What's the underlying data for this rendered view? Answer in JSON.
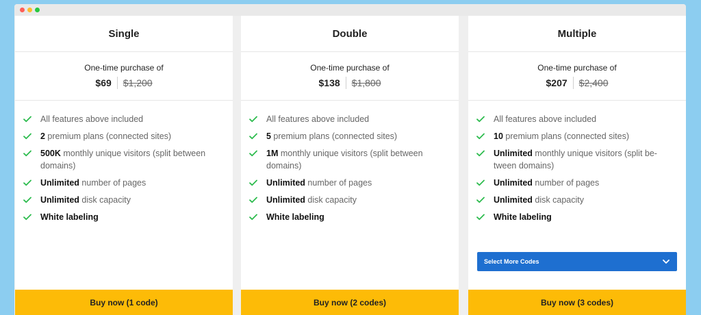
{
  "window": {
    "controls": [
      "close",
      "minimize",
      "maximize"
    ]
  },
  "accent": {
    "check": "#2ebc4f",
    "buy": "#fdbb07",
    "select": "#1e6fd0"
  },
  "plans": [
    {
      "name": "Single",
      "price_label": "One-time purchase of",
      "price": "$69",
      "old_price": "$1,200",
      "features": [
        {
          "bold": "",
          "text": "All features above included"
        },
        {
          "bold": "2",
          "text": " premium plans (connected sites)"
        },
        {
          "bold": "500K",
          "text": " monthly unique visitors (split between domains)"
        },
        {
          "bold": "Unlimited",
          "text": " number of pages"
        },
        {
          "bold": "Unlimited",
          "text": " disk capacity"
        },
        {
          "bold": "White labeling",
          "text": ""
        }
      ],
      "buy_label": "Buy now (1 code)"
    },
    {
      "name": "Double",
      "price_label": "One-time purchase of",
      "price": "$138",
      "old_price": "$1,800",
      "features": [
        {
          "bold": "",
          "text": "All features above included"
        },
        {
          "bold": "5",
          "text": " premium plans (connected sites)"
        },
        {
          "bold": "1M",
          "text": " monthly unique visitors (split between domains)"
        },
        {
          "bold": "Unlimited",
          "text": " number of pages"
        },
        {
          "bold": "Unlimited",
          "text": " disk capacity"
        },
        {
          "bold": "White labeling",
          "text": ""
        }
      ],
      "buy_label": "Buy now (2 codes)"
    },
    {
      "name": "Multiple",
      "price_label": "One-time purchase of",
      "price": "$207",
      "old_price": "$2,400",
      "features": [
        {
          "bold": "",
          "text": "All features above included"
        },
        {
          "bold": "10",
          "text": " premium plans (connected sites)"
        },
        {
          "bold": "Unlimited",
          "text": " monthly unique visitors (split be- tween domains)"
        },
        {
          "bold": "Unlimited",
          "text": " number of pages"
        },
        {
          "bold": "Unlimited",
          "text": " disk capacity"
        },
        {
          "bold": "White labeling",
          "text": ""
        }
      ],
      "select_label": "Select More Codes",
      "buy_label": "Buy now (3 codes)"
    }
  ]
}
